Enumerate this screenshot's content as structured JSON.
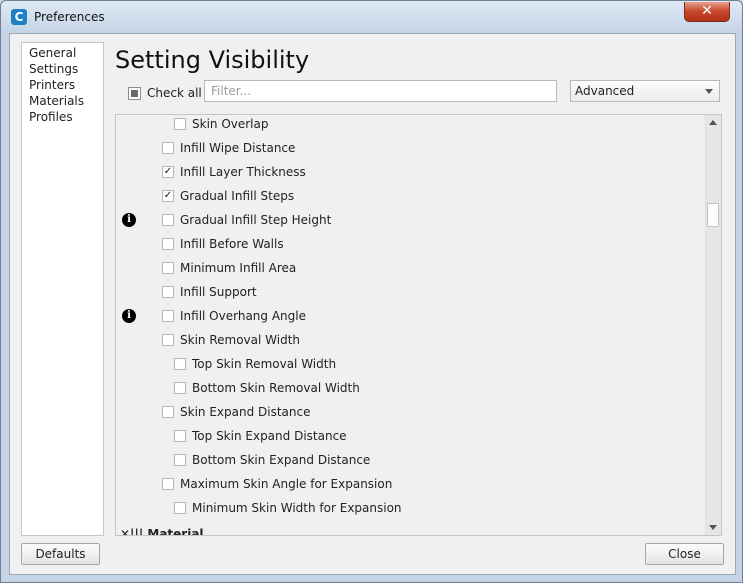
{
  "window": {
    "title": "Preferences",
    "app_icon_letter": "C",
    "close_glyph": "✕"
  },
  "sidebar": {
    "items": [
      {
        "label": "General"
      },
      {
        "label": "Settings"
      },
      {
        "label": "Printers"
      },
      {
        "label": "Materials"
      },
      {
        "label": "Profiles"
      }
    ]
  },
  "main": {
    "title": "Setting Visibility",
    "check_all_label": "Check all",
    "filter_placeholder": "Filter...",
    "filter_value": "",
    "dropdown_value": "Advanced"
  },
  "settings_list": [
    {
      "label": "Skin Overlap",
      "indent": 2,
      "checked": false,
      "info": false
    },
    {
      "label": "Infill Wipe Distance",
      "indent": 1,
      "checked": false,
      "info": false
    },
    {
      "label": "Infill Layer Thickness",
      "indent": 1,
      "checked": true,
      "info": false
    },
    {
      "label": "Gradual Infill Steps",
      "indent": 1,
      "checked": true,
      "info": false
    },
    {
      "label": "Gradual Infill Step Height",
      "indent": 1,
      "checked": false,
      "info": true
    },
    {
      "label": "Infill Before Walls",
      "indent": 1,
      "checked": false,
      "info": false
    },
    {
      "label": "Minimum Infill Area",
      "indent": 1,
      "checked": false,
      "info": false
    },
    {
      "label": "Infill Support",
      "indent": 1,
      "checked": false,
      "info": false
    },
    {
      "label": "Infill Overhang Angle",
      "indent": 1,
      "checked": false,
      "info": true
    },
    {
      "label": "Skin Removal Width",
      "indent": 1,
      "checked": false,
      "info": false
    },
    {
      "label": "Top Skin Removal Width",
      "indent": 2,
      "checked": false,
      "info": false
    },
    {
      "label": "Bottom Skin Removal Width",
      "indent": 2,
      "checked": false,
      "info": false
    },
    {
      "label": "Skin Expand Distance",
      "indent": 1,
      "checked": false,
      "info": false
    },
    {
      "label": "Top Skin Expand Distance",
      "indent": 2,
      "checked": false,
      "info": false
    },
    {
      "label": "Bottom Skin Expand Distance",
      "indent": 2,
      "checked": false,
      "info": false
    },
    {
      "label": "Maximum Skin Angle for Expansion",
      "indent": 1,
      "checked": false,
      "info": false
    },
    {
      "label": "Minimum Skin Width for Expansion",
      "indent": 2,
      "checked": false,
      "info": false
    }
  ],
  "category_partial": {
    "label": "Material",
    "icon": "material-icon"
  },
  "info_glyph": "i",
  "check_glyph": "✓",
  "scroll_position": 0.2,
  "footer": {
    "defaults_label": "Defaults",
    "close_label": "Close"
  },
  "colors": {
    "accent": "#1d7fc4",
    "close_button": "#c7462c"
  }
}
